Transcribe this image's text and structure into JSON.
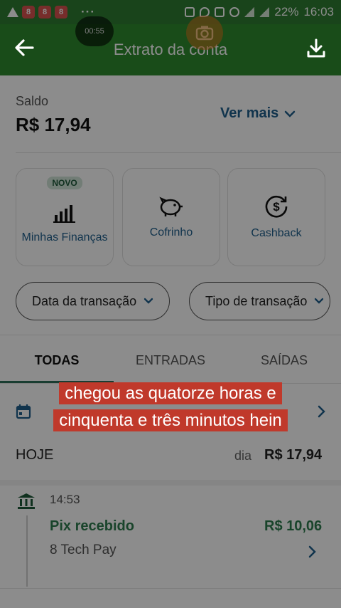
{
  "status_bar": {
    "badges": [
      "8",
      "8",
      "8"
    ],
    "battery": "22%",
    "time": "16:03"
  },
  "recording": {
    "timer": "00:55"
  },
  "app_bar": {
    "title": "Extrato da conta"
  },
  "balance": {
    "label": "Saldo",
    "value": "R$ 17,94",
    "more_label": "Ver mais"
  },
  "cards": [
    {
      "label": "Minhas Finanças",
      "badge": "NOVO",
      "icon": "bar-chart-icon"
    },
    {
      "label": "Cofrinho",
      "icon": "piggy-bank-icon"
    },
    {
      "label": "Cashback",
      "icon": "cashback-icon"
    }
  ],
  "filters": [
    {
      "label": "Data da transação"
    },
    {
      "label": "Tipo de transação"
    }
  ],
  "tabs": [
    {
      "label": "TODAS",
      "active": true
    },
    {
      "label": "ENTRADAS",
      "active": false
    },
    {
      "label": "SAÍDAS",
      "active": false
    }
  ],
  "day_group": {
    "label": "HOJE",
    "balance_label": "dia",
    "balance_value": "R$ 17,94"
  },
  "transaction": {
    "time": "14:53",
    "title": "Pix recebido",
    "amount": "R$ 10,06",
    "counterparty": "8 Tech Pay"
  },
  "caption": {
    "text": "chegou as quatorze horas e cinquenta e três minutos hein"
  },
  "colors": {
    "brand_green": "#2e8b2e",
    "income_green": "#2e7d4f",
    "link_blue": "#1f5f8c",
    "caption_red": "#c0392b"
  }
}
